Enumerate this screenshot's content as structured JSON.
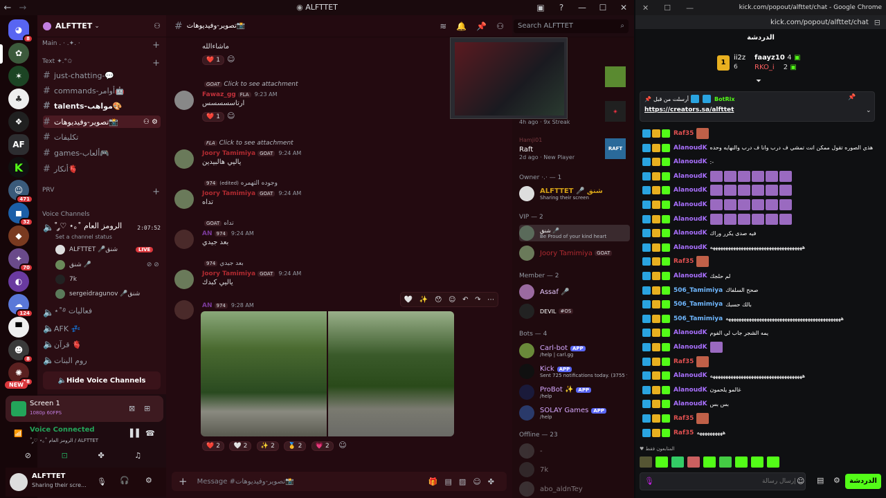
{
  "discord": {
    "window_title": "ALFTTET",
    "search_placeholder": "Search ALFTTET",
    "server_name": "ALFTTET",
    "channel_header": "تصوير-وفيديوهات📸",
    "rail_badges": [
      "8",
      "471",
      "32",
      "70",
      "124",
      "8",
      "18"
    ],
    "rail_new": "NEW",
    "rail_af": "AF",
    "categories": {
      "main": "Main . · .✦. ·",
      "text": "Text ✦.°✩",
      "prv": "PRV",
      "voice": "Voice Channels"
    },
    "channels": [
      {
        "label": "just-chatting-💬"
      },
      {
        "label": "commands-أوامر🤖"
      },
      {
        "label": "talents-مواهب🎨"
      },
      {
        "label": "تصوير-وفيديوهات📸"
      },
      {
        "label": "تكليفات"
      },
      {
        "label": "games-ألعاب🎮"
      },
      {
        "label": "أنكار🫀"
      }
    ],
    "voice_channel": {
      "name": "˚ ༘♡ ⋆｡˚ الرومز العام",
      "timer": "2:07:52",
      "status": "Set a channel status",
      "users": [
        {
          "name": "ALFTTET 🎤شنق",
          "live": "LIVE"
        },
        {
          "name": "شنق 🎤"
        },
        {
          "name": "7k"
        },
        {
          "name": "sergeidragunov 🎤شنق"
        }
      ]
    },
    "other_voice": [
      "⋆˚࿔ فعاليات",
      "AFK 💤",
      "قرآن 🫀",
      "روم البنات"
    ],
    "hide_voice": "Hide Voice Channels",
    "screen": {
      "title": "Screen 1",
      "sub": "1080p 60FPS"
    },
    "voice_connected": {
      "title": "Voice Connected",
      "sub": "˚ ༘♡ ⋆｡˚ الرومز العام / ALFTTET"
    },
    "user": {
      "name": "ALFTTET",
      "status": "Sharing their scre..."
    },
    "message_placeholder": "Message #تصوير-وفيديوهات📸",
    "messages": [
      {
        "text": "ماشاءالله",
        "reactions": [
          {
            "emoji": "❤️",
            "count": "1"
          }
        ]
      },
      {
        "reply": "Click to see attachment",
        "reply_tag": "GOAT",
        "name": "Fawaz_gg",
        "tag": "FLA",
        "time": "9:23 AM",
        "text": "ارتاسسسسس",
        "reactions": [
          {
            "emoji": "❤️",
            "count": "1"
          }
        ]
      },
      {
        "reply": "Click to see attachment",
        "reply_tag": "FLA",
        "name": "Joory Tamimiya",
        "tag": "GOAT",
        "time": "9:24 AM",
        "text": "ياليي هالبيدين"
      },
      {
        "reply": "وجوده التهمره",
        "reply_tag": "974",
        "name": "Joory Tamimiya",
        "tag": "GOAT",
        "time": "9:24 AM",
        "text": "تداه",
        "reply_edited": "(edited)"
      },
      {
        "reply": "تداه",
        "reply_tag": "GOAT",
        "name": "AN",
        "tag": "974",
        "time": "9:24 AM",
        "text": "بعد جيدي"
      },
      {
        "reply": "بعد جيدي",
        "reply_tag": "974",
        "name": "Joory Tamimiya",
        "tag": "GOAT",
        "time": "9:24 AM",
        "text": "ياليي كبدك"
      },
      {
        "name": "AN",
        "tag": "974",
        "time": "9:28 AM",
        "reactions": [
          {
            "emoji": "❤️",
            "count": "2"
          },
          {
            "emoji": "🤍",
            "count": "2"
          },
          {
            "emoji": "✨",
            "count": "2"
          },
          {
            "emoji": "🥇",
            "count": "2"
          },
          {
            "emoji": "💗",
            "count": "2"
          }
        ]
      }
    ],
    "members": {
      "raft_title": "Raft",
      "raft_sub1": "2d ago",
      "raft_sub2": "New Player",
      "top_sub1": "4h ago",
      "top_sub2": "9x Streak",
      "raft_user": "Hamji01",
      "owner_header": "Owner ·.· — 1",
      "owner": {
        "name": "ALFTTET 🎤 شنق",
        "status": "Sharing their screen"
      },
      "vip_header": "VIP — 2",
      "vip": [
        {
          "name": "شنق 🎤",
          "status": "Be Proud of your kind heart"
        },
        {
          "name": "Joory Tamimiya",
          "tag": "GOAT"
        }
      ],
      "member_header": "Member — 2",
      "member": [
        {
          "name": "Assaf 🎤"
        },
        {
          "name": "DEVIL",
          "tag": "#OS"
        }
      ],
      "bots_header": "Bots — 4",
      "bots": [
        {
          "name": "Carl-bot",
          "app": "APP",
          "status": "/help | carl.gg"
        },
        {
          "name": "Kick",
          "app": "APP",
          "status": "Sent 725 notifications today. (3755 ye"
        },
        {
          "name": "ProBot ✨",
          "app": "APP",
          "status": "/help"
        },
        {
          "name": "SOLAY Games",
          "app": "APP",
          "status": "/help"
        }
      ],
      "offline_header": "Offline — 23",
      "offline": [
        "-",
        "7k",
        "abo_aldnTey"
      ]
    }
  },
  "kick": {
    "window_title": "kick.com/popout/alfttet/chat - Google Chrome",
    "url": "kick.com/popout/alfttet/chat",
    "chat_title": "الدردشة",
    "leaderboard": [
      {
        "name": "ii2z",
        "count": "6"
      },
      {
        "name": "faayz10",
        "count": "4"
      },
      {
        "name": "RKO_i",
        "count": "2"
      }
    ],
    "rank": "1",
    "pinned_by": "BotRix",
    "pinned_label": "أرسلت من قبل",
    "pinned_link": "https://creators.sa/alfttet",
    "messages": [
      {
        "user": "Raf35",
        "color": "#e05050",
        "text": ""
      },
      {
        "user": "AlanoudK",
        "color": "#a970ff",
        "text": "هذي الصوره تقول ممكن انت تمشي ف درب وانا ف درب والنهايه وحده"
      },
      {
        "user": "AlanoudK",
        "color": "#a970ff",
        "text": ":-"
      },
      {
        "user": "AlanoudK",
        "color": "#a970ff",
        "text": ""
      },
      {
        "user": "AlanoudK",
        "color": "#a970ff",
        "text": ""
      },
      {
        "user": "AlanoudK",
        "color": "#a970ff",
        "text": ""
      },
      {
        "user": "AlanoudK",
        "color": "#a970ff",
        "text": ""
      },
      {
        "user": "AlanoudK",
        "color": "#a970ff",
        "text": "فيه صدى يكرر وراك"
      },
      {
        "user": "AlanoudK",
        "color": "#a970ff",
        "text": "ههههههههههههههههههههههههههههههههههههه"
      },
      {
        "user": "Raf35",
        "color": "#e05050",
        "text": ""
      },
      {
        "user": "AlanoudK",
        "color": "#a970ff",
        "text": "لم حلجك"
      },
      {
        "user": "506_Tamimiya",
        "color": "#6fb7ff",
        "text": "صحح السلفاك"
      },
      {
        "user": "506_Tamimiya",
        "color": "#6fb7ff",
        "text": "بالك حسبك"
      },
      {
        "user": "506_Tamimiya",
        "color": "#6fb7ff",
        "text": "هههههههههههههههههههههههههههههههههههههههههههههه"
      },
      {
        "user": "AlanoudK",
        "color": "#a970ff",
        "text": "يمه الشجر جاب لي الفوم"
      },
      {
        "user": "AlanoudK",
        "color": "#a970ff",
        "text": ""
      },
      {
        "user": "Raf35",
        "color": "#e05050",
        "text": ""
      },
      {
        "user": "AlanoudK",
        "color": "#a970ff",
        "text": "ههههههههههههههههههههههههههههههههههههه"
      },
      {
        "user": "AlanoudK",
        "color": "#a970ff",
        "text": "غالمو يلحمون"
      },
      {
        "user": "AlanoudK",
        "color": "#a970ff",
        "text": "بس بس"
      },
      {
        "user": "Raf35",
        "color": "#e05050",
        "text": ""
      },
      {
        "user": "Raf35",
        "color": "#e05050",
        "text": "ههههههههههه"
      }
    ],
    "recent_label": "المتابعون فقط",
    "input_placeholder": "إرسال رسالة",
    "send_label": "الدردشة"
  }
}
